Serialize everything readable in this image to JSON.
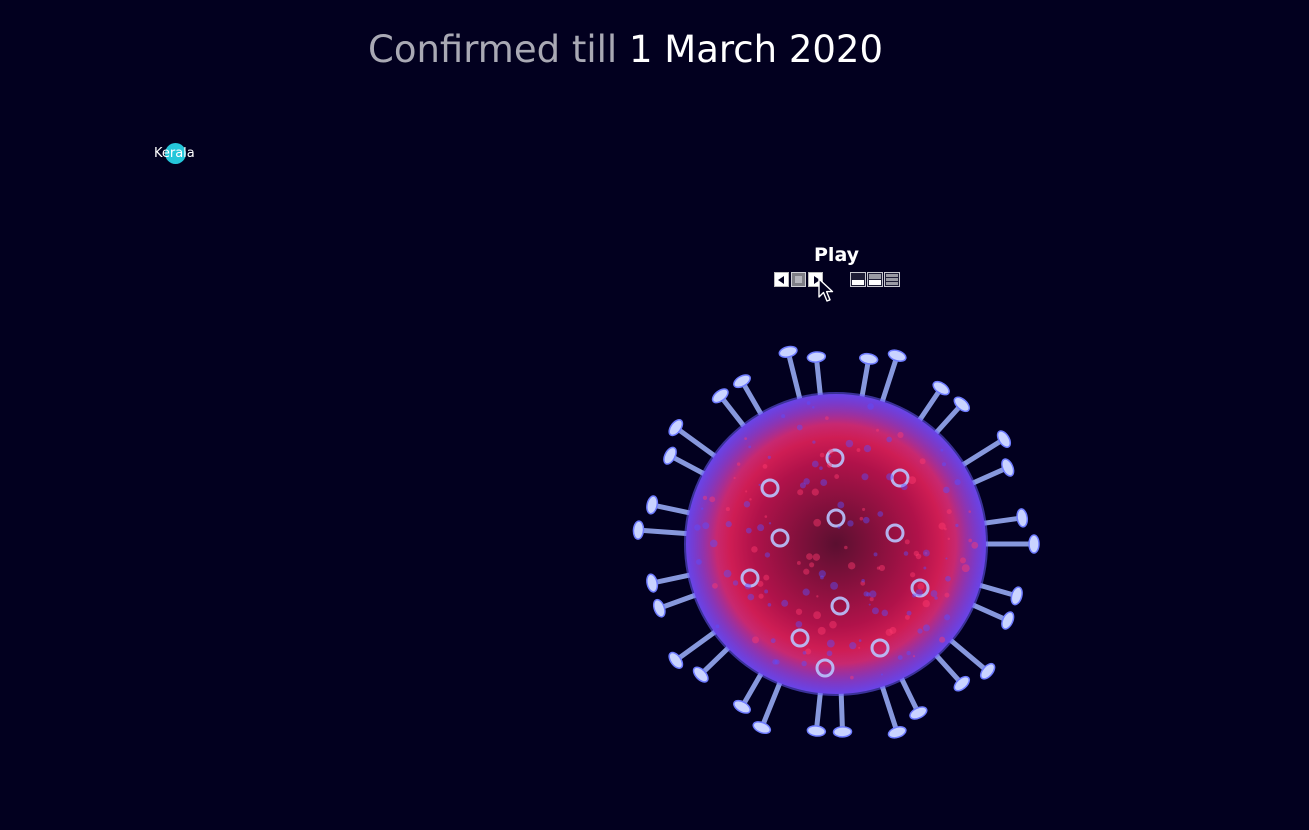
{
  "header": {
    "title_prefix": "Confirmed till",
    "title_date": "1 March 2020"
  },
  "bubbles": [
    {
      "label": "Kerala",
      "color": "#25c6da"
    }
  ],
  "controls": {
    "play_label": "Play",
    "prev_icon": "skip-back-icon",
    "stop_icon": "stop-icon",
    "next_icon": "play-forward-icon",
    "view_icons": [
      "layout-bottom-icon",
      "layout-split-icon",
      "layout-rows-icon"
    ]
  },
  "colors": {
    "background": "#02001f",
    "bubble": "#25c6da",
    "title_muted": "#a9a9b4",
    "title_bright": "#ffffff"
  }
}
